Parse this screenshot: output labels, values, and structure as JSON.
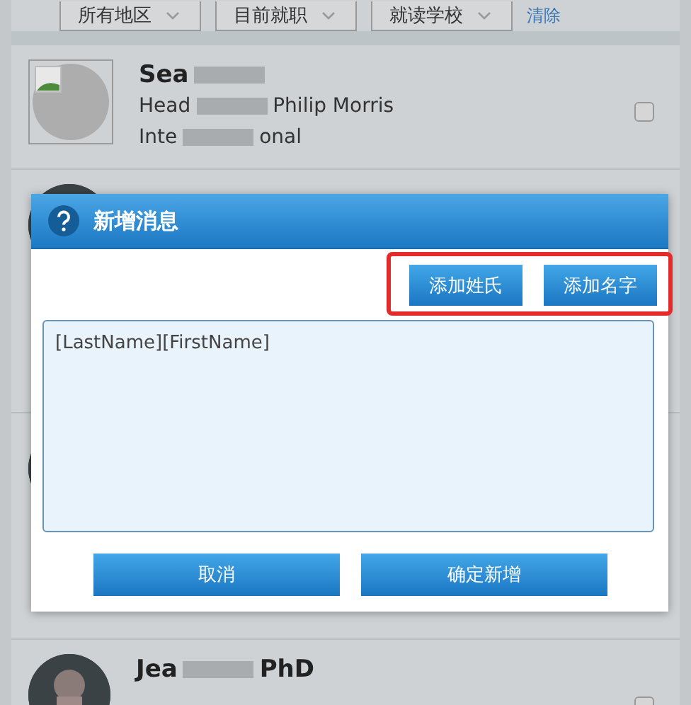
{
  "filters": [
    {
      "label": "所有地区"
    },
    {
      "label": "目前就职"
    },
    {
      "label": "就读学校"
    }
  ],
  "clear_link": "清除",
  "contacts": [
    {
      "kind": "placeholder",
      "name": [
        "Sea"
      ],
      "lines": [
        [
          "Head",
          "Philip Morris"
        ],
        [
          "Inte",
          "onal"
        ]
      ],
      "checked": false
    },
    {
      "kind": "picture"
    },
    {
      "kind": "picture"
    },
    {
      "kind": "picture",
      "name": [
        "Jea",
        "PhD"
      ],
      "checked": false
    }
  ],
  "dialog": {
    "title": "新增消息",
    "highlighted": true,
    "insert_buttons": [
      "添加姓氏",
      "添加名字"
    ],
    "message": "[LastName][FirstName]",
    "actions": [
      "取消",
      "确定新增"
    ]
  }
}
